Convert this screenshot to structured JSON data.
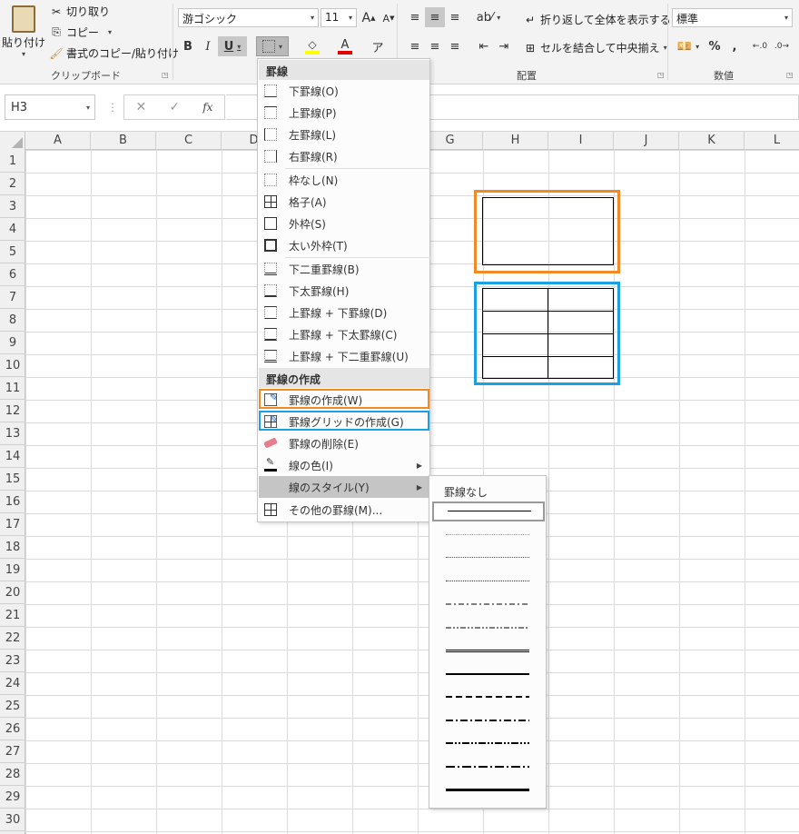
{
  "ribbon": {
    "paste_label": "貼り付け",
    "cut_label": "切り取り",
    "copy_label": "コピー",
    "format_painter_label": "書式のコピー/貼り付け",
    "clipboard_group": "クリップボード",
    "font_name": "游ゴシック",
    "font_size": "11",
    "bold": "B",
    "italic": "I",
    "underline": "U",
    "grow_font": "A",
    "shrink_font": "A",
    "font_color_letter": "A",
    "wrap_text_label": "折り返して全体を表示する",
    "merge_center_label": "セルを結合して中央揃え",
    "alignment_group": "配置",
    "number_format": "標準",
    "percent": "%",
    "comma": ",",
    "number_group": "数値",
    "fill_color": "#FFFF00",
    "font_color": "#E00000"
  },
  "formula_bar": {
    "name_box": "H3",
    "cancel": "✕",
    "enter": "✓",
    "fx": "fx",
    "value": ""
  },
  "sheet": {
    "columns": [
      "A",
      "B",
      "C",
      "D",
      "E",
      "F",
      "G",
      "H",
      "I",
      "J",
      "K",
      "L"
    ],
    "rows": [
      "1",
      "2",
      "3",
      "4",
      "5",
      "6",
      "7",
      "8",
      "9",
      "10",
      "11",
      "12",
      "13",
      "14",
      "15",
      "16",
      "17",
      "18",
      "19",
      "20",
      "21",
      "22",
      "23",
      "24",
      "25",
      "26",
      "27",
      "28",
      "29",
      "30"
    ]
  },
  "menu": {
    "section_borders": "罫線",
    "items": [
      {
        "label": "下罫線(O)"
      },
      {
        "label": "上罫線(P)"
      },
      {
        "label": "左罫線(L)"
      },
      {
        "label": "右罫線(R)"
      },
      {
        "label": "枠なし(N)"
      },
      {
        "label": "格子(A)"
      },
      {
        "label": "外枠(S)"
      },
      {
        "label": "太い外枠(T)"
      },
      {
        "label": "下二重罫線(B)"
      },
      {
        "label": "下太罫線(H)"
      },
      {
        "label": "上罫線 + 下罫線(D)"
      },
      {
        "label": "上罫線 + 下太罫線(C)"
      },
      {
        "label": "上罫線 + 下二重罫線(U)"
      }
    ],
    "section_draw": "罫線の作成",
    "draw_items": [
      {
        "label": "罫線の作成(W)"
      },
      {
        "label": "罫線グリッドの作成(G)"
      },
      {
        "label": "罫線の削除(E)"
      },
      {
        "label": "線の色(I)"
      },
      {
        "label": "線のスタイル(Y)"
      },
      {
        "label": "その他の罫線(M)..."
      }
    ]
  },
  "submenu": {
    "none_label": "罫線なし"
  },
  "highlight": {
    "orange": "#F08A24",
    "blue": "#1BA1E2"
  }
}
